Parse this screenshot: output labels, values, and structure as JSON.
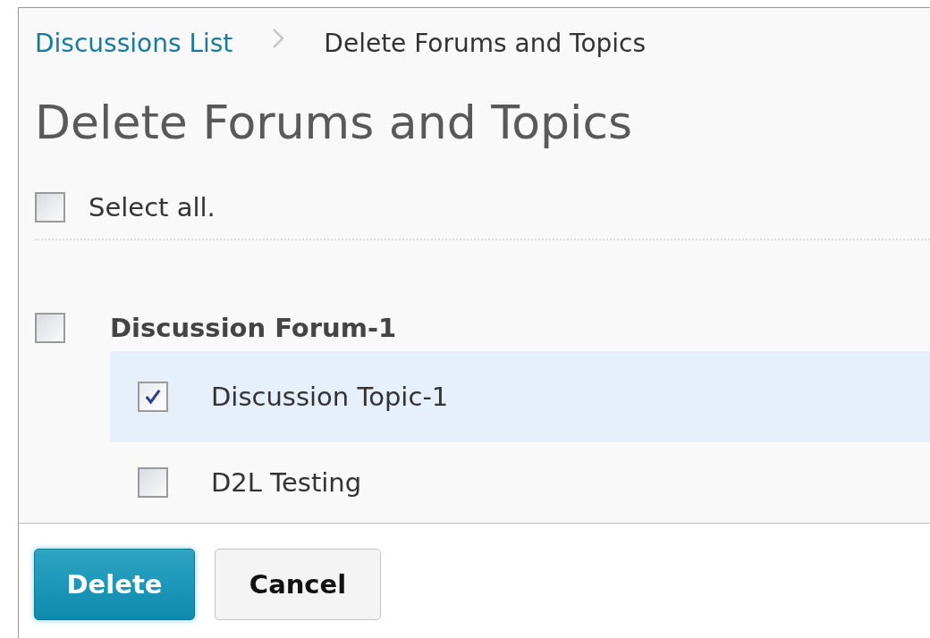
{
  "breadcrumb": {
    "link": "Discussions List",
    "current": "Delete Forums and Topics"
  },
  "title": "Delete Forums and Topics",
  "select_all": {
    "label": "Select all.",
    "checked": false
  },
  "forums": [
    {
      "name": "Discussion Forum-1",
      "checked": false,
      "children": [
        {
          "name": "Discussion Topic-1",
          "checked": true,
          "selected": true
        },
        {
          "name": "D2L Testing",
          "checked": false,
          "selected": false
        }
      ]
    }
  ],
  "buttons": [
    {
      "label": "Delete",
      "kind": "primary"
    },
    {
      "label": "Cancel",
      "kind": "secondary"
    }
  ]
}
